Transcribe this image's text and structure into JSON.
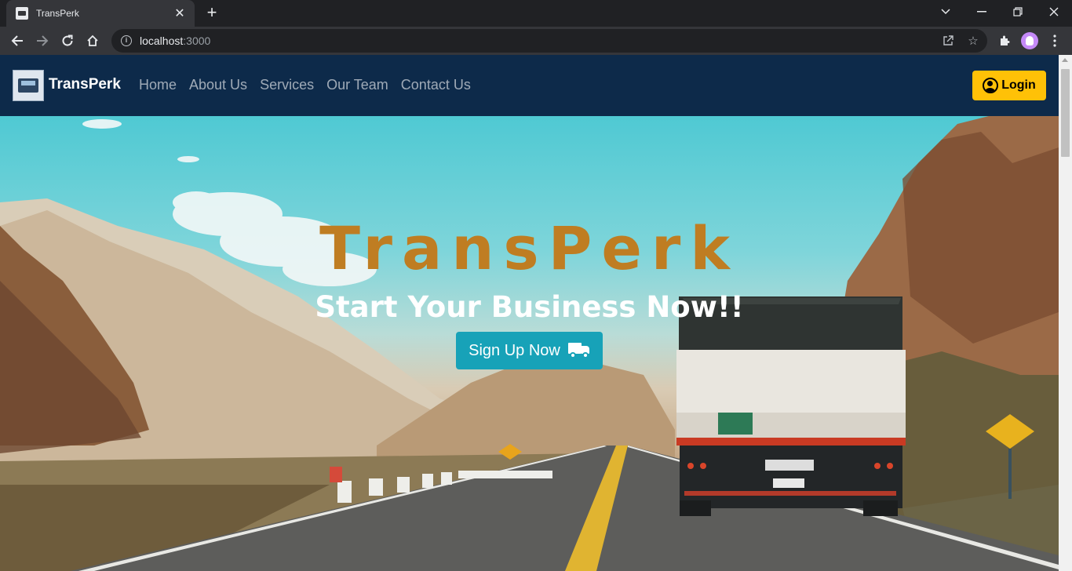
{
  "browser": {
    "tab_title": "TransPerk",
    "tab_close": "✕",
    "new_tab": "+",
    "url_host": "localhost",
    "url_port": ":3000"
  },
  "navbar": {
    "brand": "TransPerk",
    "links": [
      "Home",
      "About Us",
      "Services",
      "Our Team",
      "Contact Us"
    ],
    "login_label": "Login",
    "background": "#0d2a4a",
    "login_color": "#ffc107"
  },
  "hero": {
    "title": "TransPerk",
    "subtitle": "Start Your Business Now!!",
    "cta_label": "Sign Up Now",
    "title_color": "#bf7d22",
    "cta_color": "#17a2b8"
  }
}
